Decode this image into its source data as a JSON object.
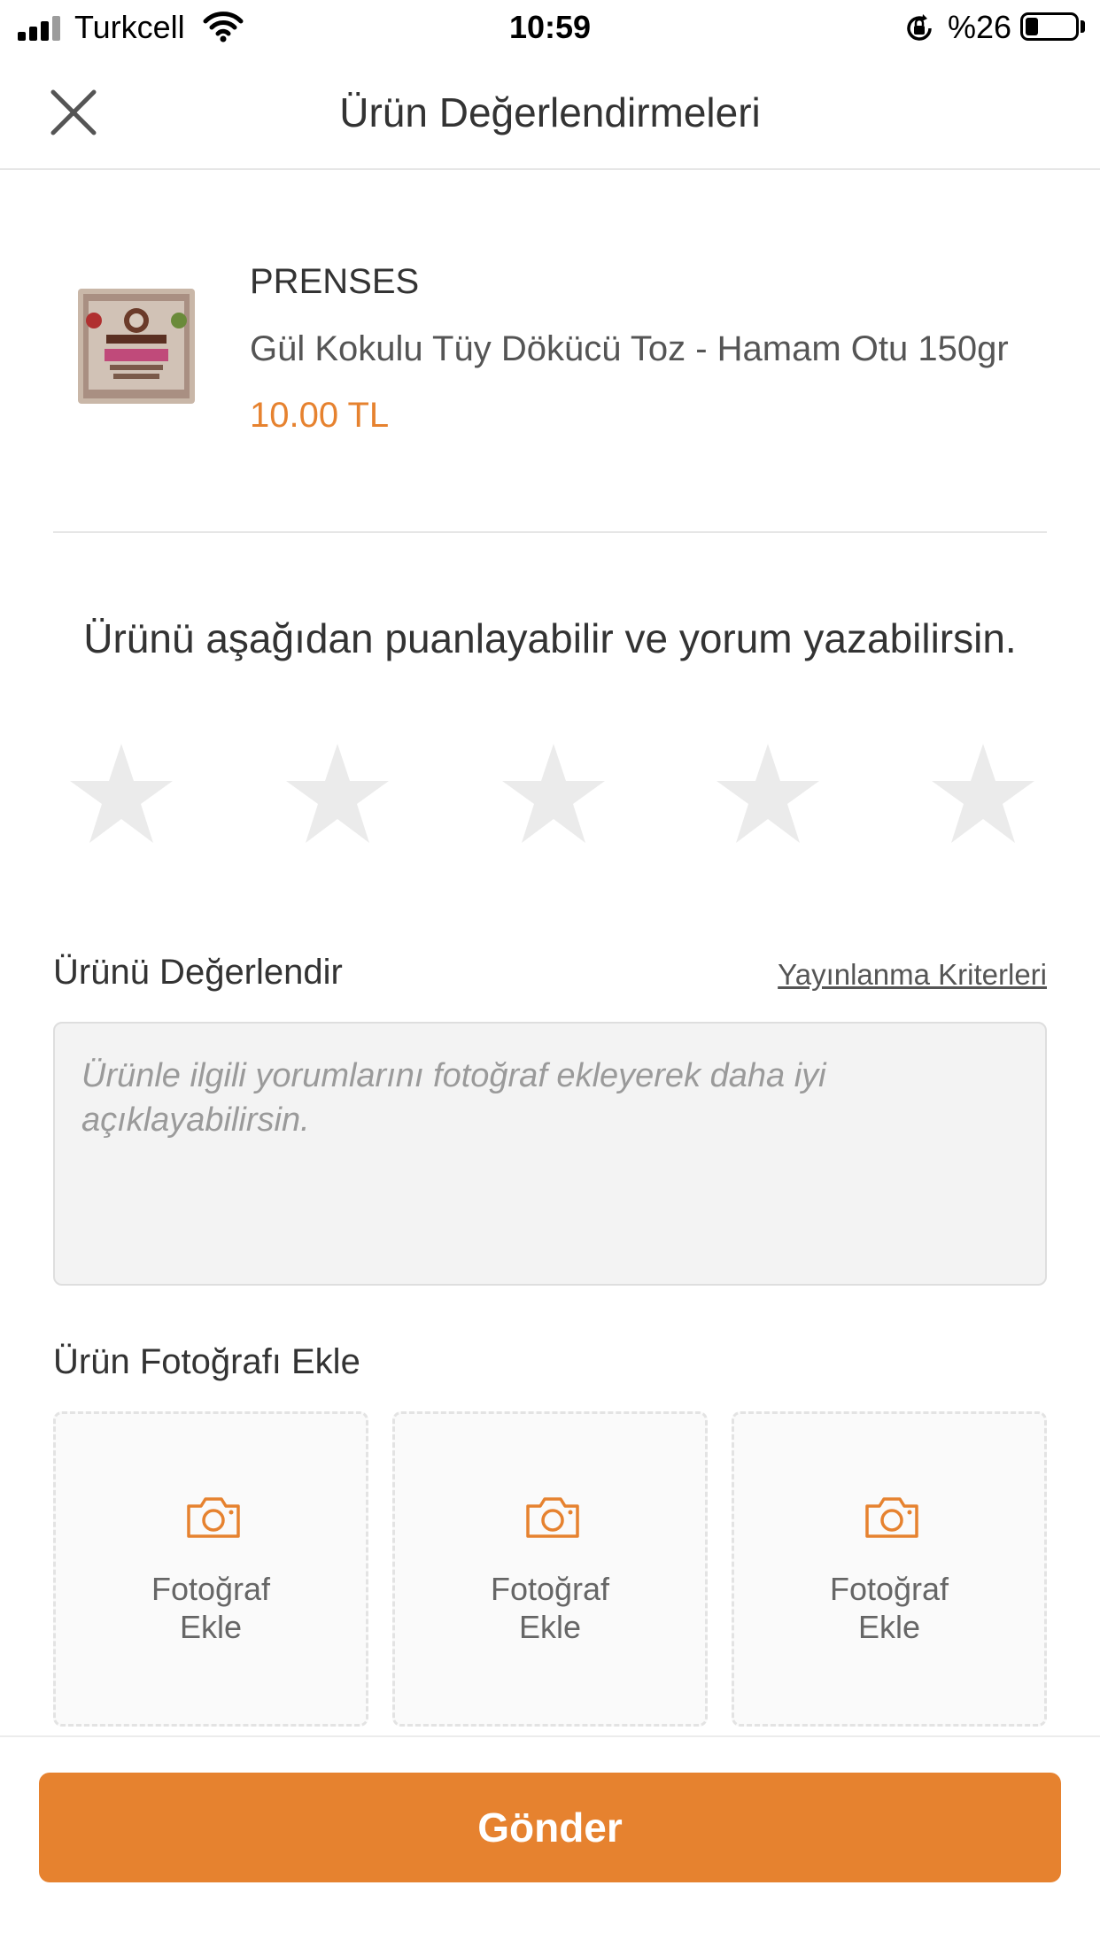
{
  "status_bar": {
    "carrier": "Turkcell",
    "time": "10:59",
    "battery": "%26",
    "battery_level": 0.26
  },
  "header": {
    "title": "Ürün Değerlendirmeleri"
  },
  "product": {
    "brand": "PRENSES",
    "name": "Gül Kokulu Tüy Dökücü Toz - Hamam Otu 150gr",
    "price": "10.00 TL"
  },
  "rating": {
    "prompt": "Ürünü aşağıdan puanlayabilir ve yorum yazabilirsin.",
    "max": 5,
    "value": 0
  },
  "review": {
    "label": "Ürünü Değerlendir",
    "criteria_link": "Yayınlanma Kriterleri",
    "placeholder": "Ürünle ilgili yorumlarını fotoğraf ekleyerek daha iyi açıklayabilirsin.",
    "value": ""
  },
  "photos": {
    "label": "Ürün Fotoğrafı Ekle",
    "slots": [
      {
        "line1": "Fotoğraf",
        "line2": "Ekle"
      },
      {
        "line1": "Fotoğraf",
        "line2": "Ekle"
      },
      {
        "line1": "Fotoğraf",
        "line2": "Ekle"
      }
    ]
  },
  "footer": {
    "submit_label": "Gönder"
  },
  "colors": {
    "accent": "#e6822f",
    "star_empty": "#ebebeb"
  }
}
